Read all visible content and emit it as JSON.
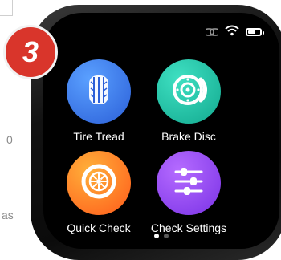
{
  "background_text": {
    "fragment_1": "0",
    "fragment_2": "as"
  },
  "step_badge": "3",
  "status_bar": {
    "icons": [
      "link-icon",
      "wifi-icon",
      "battery-icon"
    ],
    "battery_level": 0.55
  },
  "apps": [
    {
      "label": "Tire Tread",
      "icon": "tire-tread-icon",
      "color_top": "#5aa0ff",
      "color_bottom": "#2b5fd8"
    },
    {
      "label": "Brake Disc",
      "icon": "brake-disc-icon",
      "color_top": "#3fe0c2",
      "color_bottom": "#12a98f"
    },
    {
      "label": "Quick Check",
      "icon": "wheel-icon",
      "color_top": "#ffb03a",
      "color_bottom": "#ff5a1a"
    },
    {
      "label": "Check Settings",
      "icon": "sliders-icon",
      "color_top": "#b56bff",
      "color_bottom": "#7a32e6"
    }
  ],
  "page_indicator": {
    "total": 2,
    "current": 1
  },
  "colors": {
    "accent_red": "#d9352b",
    "screen_bg": "#000000"
  }
}
